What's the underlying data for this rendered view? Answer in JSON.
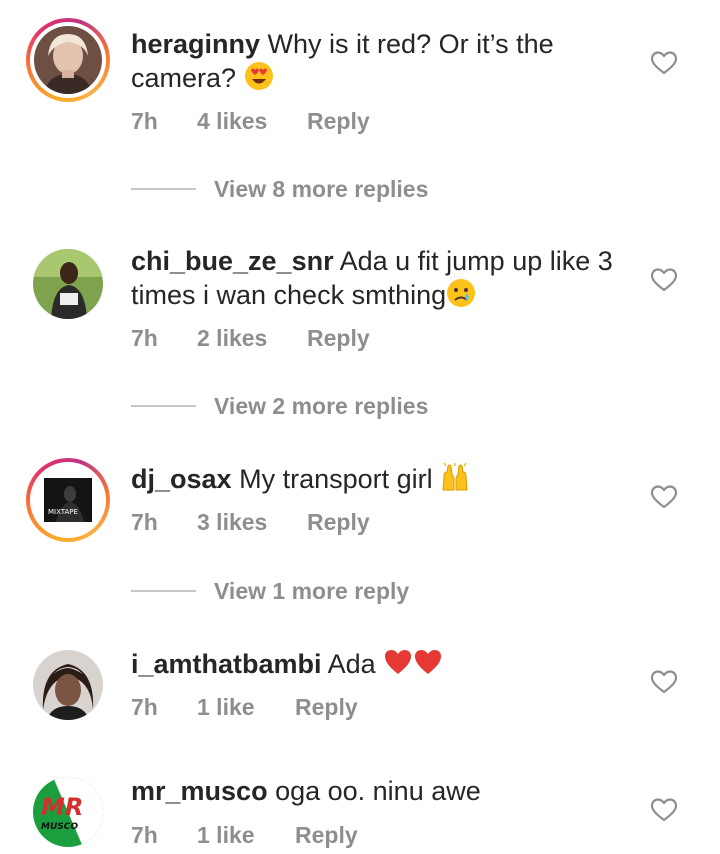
{
  "comments": [
    {
      "username": "heraginny",
      "text": "Why is it red? Or it’s the camera?",
      "emoji": [
        "heart-eyes-emoji"
      ],
      "time": "7h",
      "likes": "4 likes",
      "reply_label": "Reply",
      "view_more": "View 8 more replies",
      "has_story_ring": true,
      "avatar_colors": [
        "#a77b66",
        "#e6c9b8"
      ]
    },
    {
      "username": "chi_bue_ze_snr",
      "text": "Ada u fit jump up like 3 times i wan check smthing",
      "emoji": [
        "crying-face-emoji"
      ],
      "time": "7h",
      "likes": "2 likes",
      "reply_label": "Reply",
      "view_more": "View 2 more replies",
      "has_story_ring": false,
      "avatar_colors": [
        "#5d7d3a",
        "#2b2b2b"
      ]
    },
    {
      "username": "dj_osax",
      "text": "My transport girl",
      "emoji": [
        "raising-hands-emoji"
      ],
      "time": "7h",
      "likes": "3 likes",
      "reply_label": "Reply",
      "view_more": "View 1 more reply",
      "has_story_ring": true,
      "avatar_colors": [
        "#141414",
        "#3a3a3a"
      ],
      "avatar_text": "MIXTAPE"
    },
    {
      "username": "i_amthatbambi",
      "text": "Ada",
      "emoji": [
        "red-heart-emoji",
        "red-heart-emoji"
      ],
      "time": "7h",
      "likes": "1 like",
      "reply_label": "Reply",
      "has_story_ring": false,
      "avatar_colors": [
        "#3b2a22",
        "#8a6450"
      ]
    },
    {
      "username": "mr_musco",
      "text": "oga oo. ninu awe",
      "emoji": [],
      "time": "7h",
      "likes": "1 like",
      "reply_label": "Reply",
      "has_story_ring": false,
      "avatar_colors": [
        "#1b9e3e",
        "#d32f2f"
      ],
      "avatar_text": "MR",
      "avatar_subtext": "MUSCO"
    }
  ],
  "colors": {
    "text": "#262626",
    "secondary": "#8e8e8e",
    "divider": "#c7c7c7",
    "heart_outline": "#8e8e8e"
  },
  "icons": {
    "like": "heart-outline-icon"
  }
}
